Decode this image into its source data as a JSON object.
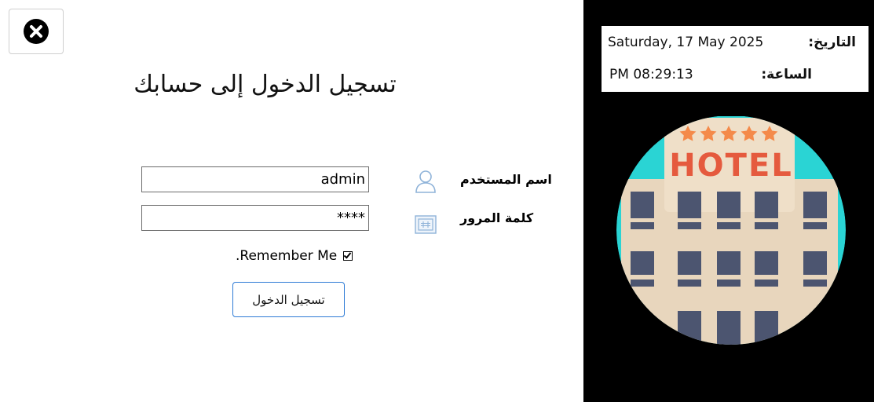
{
  "login": {
    "title": "تسجيل الدخول إلى حسابك",
    "username_label": "اسم المستخدم",
    "username_value": "admin",
    "password_label": "كلمة المرور",
    "password_value": "****",
    "remember_label": ".Remember Me",
    "remember_checked": true,
    "submit_label": "تسجيل الدخول"
  },
  "clock": {
    "date_label": "التاريخ:",
    "date_value": "Saturday, 17 May 2025",
    "time_label": "الساعة:",
    "time_value": "PM 08:29:13"
  },
  "hotel_sign": "HOTEL",
  "icons": [
    "close-icon",
    "user-icon",
    "keypad-icon",
    "check-icon",
    "hotel-illustration"
  ],
  "colors": {
    "panel_background": "#000000",
    "button_border": "#2e7bd6",
    "circle": "#2ad4d4",
    "sign_text": "#e55a3e",
    "stars": "#f48a4a",
    "building": "#e8d6bd",
    "windows": "#4c5570"
  }
}
